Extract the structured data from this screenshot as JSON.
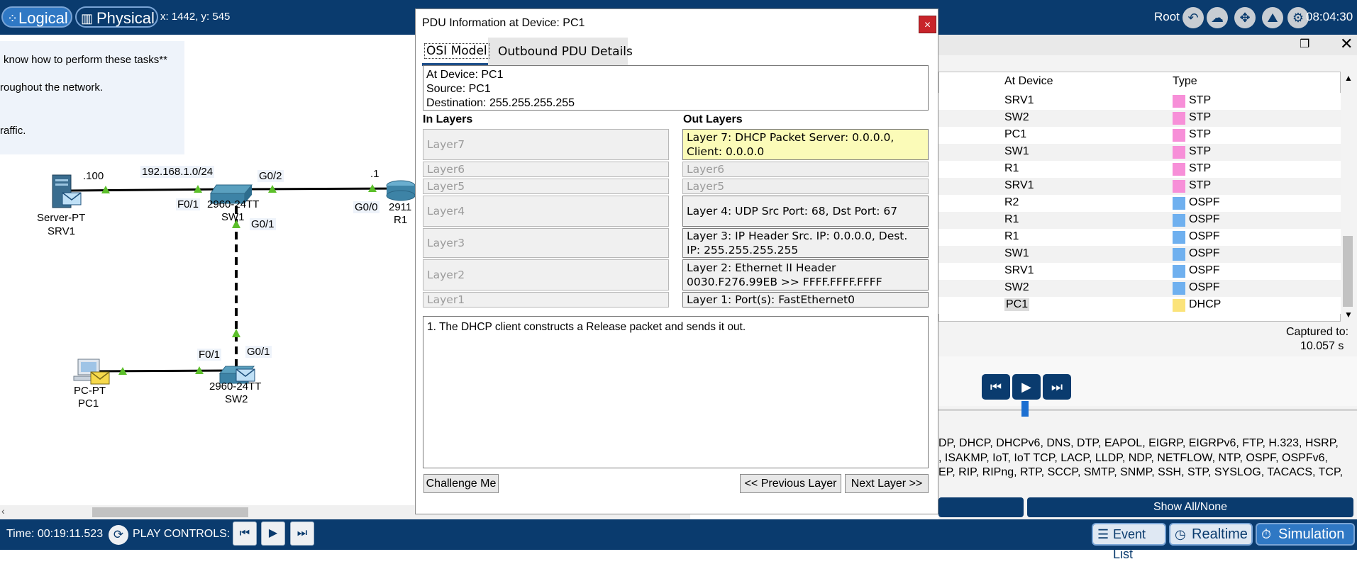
{
  "topbar": {
    "logical_label": "Logical",
    "physical_label": "Physical",
    "coords": "x: 1442, y: 545",
    "root_label": "Root",
    "clock": "08:04:30"
  },
  "workspace": {
    "notes": {
      "line1": "know how to perform these tasks**",
      "line2": "roughout the network.",
      "line3": "raffic."
    },
    "topology": {
      "srv_ip": ".100",
      "subnet": "192.168.1.0/24",
      "sw1_g02": "G0/2",
      "r1_ip": ".1",
      "sw1_f01": "F0/1",
      "sw1_model": "2960-24TT",
      "sw1_name": "SW1",
      "sw1_g01": "G0/1",
      "r1_g00": "G0/0",
      "r1_model": "2911",
      "r1_name": "R1",
      "srv_model": "Server-PT",
      "srv_name": "SRV1",
      "sw2_f01": "F0/1",
      "sw2_g01": "G0/1",
      "sw2_model": "2960-24TT",
      "sw2_name": "SW2",
      "pc_model": "PC-PT",
      "pc_name": "PC1"
    }
  },
  "dialog": {
    "title": "PDU Information at Device: PC1",
    "close_label": "×",
    "tabs": [
      "OSI Model",
      "Outbound PDU Details"
    ],
    "info": {
      "at_device": "At Device: PC1",
      "source": "Source: PC1",
      "destination": "Destination: 255.255.255.255"
    },
    "in_layers_heading": "In Layers",
    "out_layers_heading": "Out Layers",
    "in_layers": [
      "Layer7",
      "Layer6",
      "Layer5",
      "Layer4",
      "Layer3",
      "Layer2",
      "Layer1"
    ],
    "out_layers": [
      "Layer 7: DHCP Packet Server: 0.0.0.0, Client: 0.0.0.0",
      "Layer6",
      "Layer5",
      "Layer 4: UDP Src Port: 68, Dst Port: 67",
      "Layer 3: IP Header Src. IP: 0.0.0.0, Dest. IP: 255.255.255.255",
      "Layer 2: Ethernet II Header 0030.F276.99EB >> FFFF.FFFF.FFFF",
      "Layer 1: Port(s): FastEthernet0"
    ],
    "description": "1. The DHCP client constructs a Release packet and sends it out.",
    "challenge_label": "Challenge Me",
    "prev_label": "<< Previous Layer",
    "next_label": "Next Layer >>"
  },
  "event_list": {
    "col_at_device": "At Device",
    "col_type": "Type",
    "rows": [
      {
        "device": "SRV1",
        "type": "STP",
        "color": "#f78fd8"
      },
      {
        "device": "SW2",
        "type": "STP",
        "color": "#f78fd8"
      },
      {
        "device": "PC1",
        "type": "STP",
        "color": "#f78fd8"
      },
      {
        "device": "SW1",
        "type": "STP",
        "color": "#f78fd8"
      },
      {
        "device": "R1",
        "type": "STP",
        "color": "#f78fd8"
      },
      {
        "device": "SRV1",
        "type": "STP",
        "color": "#f78fd8"
      },
      {
        "device": "R2",
        "type": "OSPF",
        "color": "#6fb0ef"
      },
      {
        "device": "R1",
        "type": "OSPF",
        "color": "#6fb0ef"
      },
      {
        "device": "R1",
        "type": "OSPF",
        "color": "#6fb0ef"
      },
      {
        "device": "SW1",
        "type": "OSPF",
        "color": "#6fb0ef"
      },
      {
        "device": "SRV1",
        "type": "OSPF",
        "color": "#6fb0ef"
      },
      {
        "device": "SW2",
        "type": "OSPF",
        "color": "#6fb0ef"
      },
      {
        "device": "PC1",
        "type": "DHCP",
        "color": "#fbe37a"
      }
    ],
    "captured_label": "Captured to:",
    "captured_value": "10.057 s",
    "protocols_line1": "DP, DHCP, DHCPv6, DNS, DTP, EAPOL, EIGRP, EIGRPv6, FTP, H.323, HSRP,",
    "protocols_line2": ", ISAKMP, IoT, IoT TCP, LACP, LLDP, NDP, NETFLOW, NTP, OSPF, OSPFv6,",
    "protocols_line3": "EP, RIP, RIPng, RTP, SCCP, SMTP, SNMP, SSH, STP, SYSLOG, TACACS, TCP,",
    "show_all_label": "Show All/None"
  },
  "bottombar": {
    "time": "Time: 00:19:11.523",
    "play_controls": "PLAY CONTROLS:",
    "event_list_label": "Event List",
    "realtime_label": "Realtime",
    "simulation_label": "Simulation"
  },
  "colors": {
    "topbar": "#0a3b6e",
    "stp": "#f78fd8",
    "ospf": "#6fb0ef",
    "dhcp": "#fbe37a",
    "layer_highlight": "#fbfbb8",
    "link_arrow": "#5cbf2a"
  }
}
